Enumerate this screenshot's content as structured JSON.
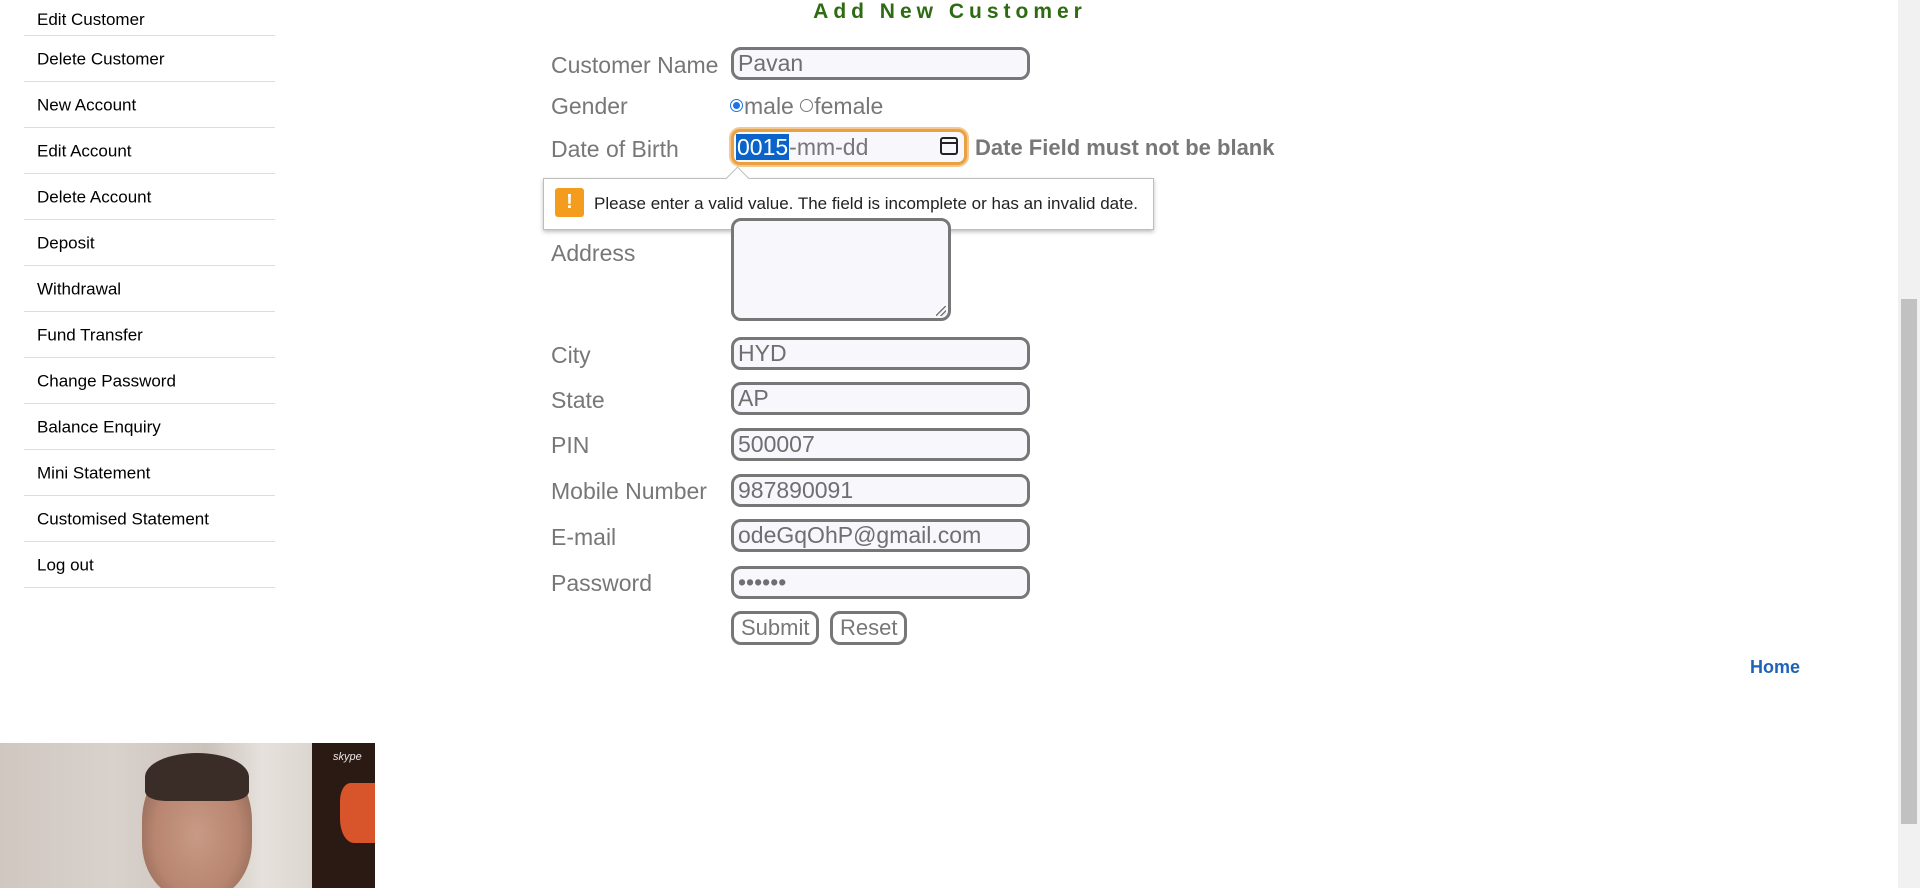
{
  "sidebar": {
    "items": [
      {
        "label": "Edit Customer"
      },
      {
        "label": "Delete Customer"
      },
      {
        "label": "New Account"
      },
      {
        "label": "Edit Account"
      },
      {
        "label": "Delete Account"
      },
      {
        "label": "Deposit"
      },
      {
        "label": "Withdrawal"
      },
      {
        "label": "Fund Transfer"
      },
      {
        "label": "Change Password"
      },
      {
        "label": "Balance Enquiry"
      },
      {
        "label": "Mini Statement"
      },
      {
        "label": "Customised Statement"
      },
      {
        "label": "Log out"
      }
    ]
  },
  "form": {
    "title": "Add New Customer",
    "customer_name": {
      "label": "Customer Name",
      "value": "Pavan"
    },
    "gender": {
      "label": "Gender",
      "options": [
        "male",
        "female"
      ],
      "selected": "male"
    },
    "dob": {
      "label": "Date of Birth",
      "value_selected": "0015",
      "value_rest": "-mm-dd",
      "error": "Date Field must not be blank"
    },
    "tooltip": {
      "icon": "!",
      "message": "Please enter a valid value. The field is incomplete or has an invalid date."
    },
    "address": {
      "label": "Address",
      "value": ""
    },
    "city": {
      "label": "City",
      "value": "HYD"
    },
    "state": {
      "label": "State",
      "value": "AP"
    },
    "pin": {
      "label": "PIN",
      "value": "500007"
    },
    "mobile": {
      "label": "Mobile Number",
      "value": "987890091"
    },
    "email": {
      "label": "E-mail",
      "value": "odeGqOhP@gmail.com"
    },
    "password": {
      "label": "Password",
      "value": "••••••"
    },
    "submit_label": "Submit",
    "reset_label": "Reset"
  },
  "home_link": "Home",
  "video": {
    "logo": "skype"
  },
  "colors": {
    "title_green": "#2e6b12",
    "link_blue": "#1e63b8",
    "focus_orange": "#e8a043",
    "warn_orange": "#f39c1d",
    "selection_blue": "#0a63c9"
  }
}
